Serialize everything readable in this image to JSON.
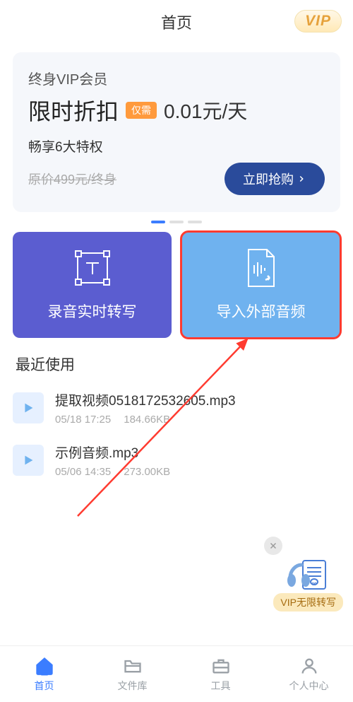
{
  "header": {
    "title": "首页",
    "vip_badge": "VIP"
  },
  "promo": {
    "line1": "终身VIP会员",
    "discount_label": "限时折扣",
    "tag": "仅需",
    "price": "0.01元/天",
    "benefits": "畅享6大特权",
    "strike_price": "原价499元/终身",
    "buy_label": "立即抢购"
  },
  "actions": {
    "transcribe": "录音实时转写",
    "import": "导入外部音频"
  },
  "recent": {
    "title": "最近使用",
    "items": [
      {
        "name": "提取视频0518172532605.mp3",
        "time": "05/18 17:25",
        "size": "184.66KB"
      },
      {
        "name": "示例音频.mp3",
        "time": "05/06 14:35",
        "size": "273.00KB"
      }
    ]
  },
  "float": {
    "label": "VIP无限转写"
  },
  "tabs": [
    {
      "label": "首页"
    },
    {
      "label": "文件库"
    },
    {
      "label": "工具"
    },
    {
      "label": "个人中心"
    }
  ]
}
